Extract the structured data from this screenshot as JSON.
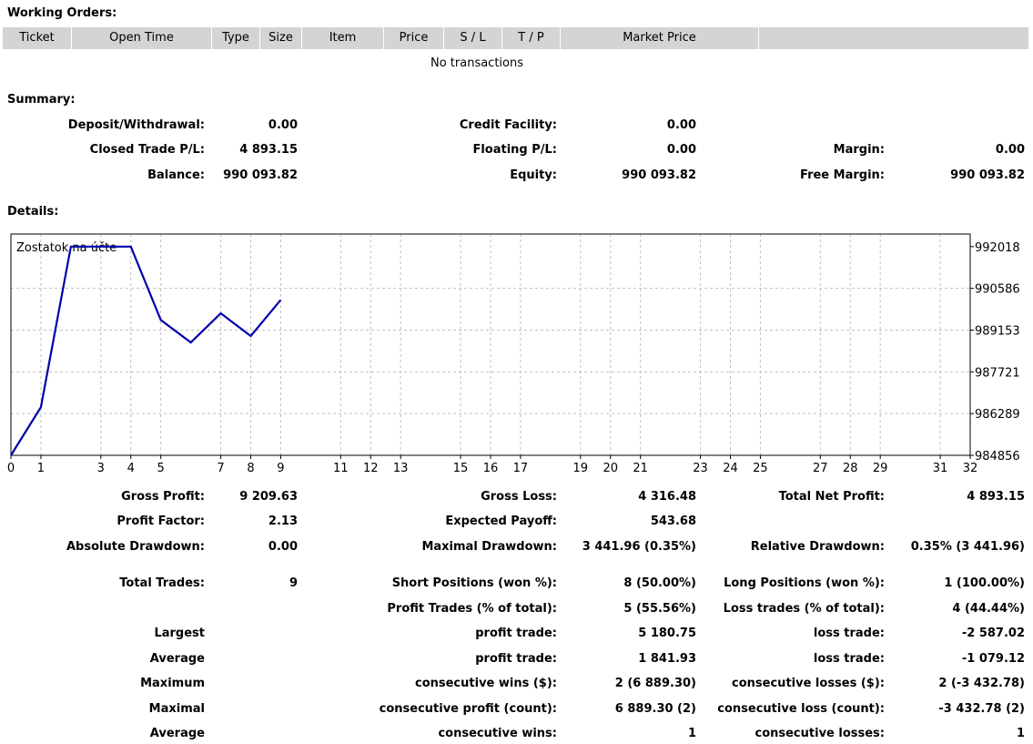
{
  "working_orders": {
    "title": "Working Orders:",
    "columns": [
      "Ticket",
      "Open Time",
      "Type",
      "Size",
      "Item",
      "Price",
      "S / L",
      "T / P",
      "Market Price"
    ],
    "empty_text": "No transactions"
  },
  "summary": {
    "title": "Summary:",
    "deposit_label": "Deposit/Withdrawal:",
    "deposit_value": "0.00",
    "credit_label": "Credit Facility:",
    "credit_value": "0.00",
    "closed_pl_label": "Closed Trade P/L:",
    "closed_pl_value": "4 893.15",
    "floating_pl_label": "Floating P/L:",
    "floating_pl_value": "0.00",
    "margin_label": "Margin:",
    "margin_value": "0.00",
    "balance_label": "Balance:",
    "balance_value": "990 093.82",
    "equity_label": "Equity:",
    "equity_value": "990 093.82",
    "free_margin_label": "Free Margin:",
    "free_margin_value": "990 093.82"
  },
  "details": {
    "title": "Details:"
  },
  "chart_data": {
    "type": "line",
    "title": "Zostatok na účte",
    "x": [
      0,
      1,
      2,
      3,
      4,
      5,
      6,
      7,
      8,
      9
    ],
    "series": [
      {
        "values": [
          984856,
          986510,
          992018,
          992018,
          992018,
          989500,
          988730,
          989730,
          988950,
          990190
        ]
      }
    ],
    "x_ticks": [
      0,
      1,
      3,
      4,
      5,
      7,
      8,
      9,
      11,
      12,
      13,
      15,
      16,
      17,
      19,
      20,
      21,
      23,
      24,
      25,
      27,
      28,
      29,
      31,
      32
    ],
    "y_ticks": [
      992018,
      990586,
      989153,
      987721,
      986289,
      984856
    ],
    "xlim": [
      0,
      32
    ],
    "ylim": [
      984856,
      992450
    ],
    "grid": true,
    "line_color": "#0000aa",
    "grid_color": "#c0c0c0"
  },
  "stats": {
    "gross_profit_label": "Gross Profit:",
    "gross_profit_value": "9 209.63",
    "gross_loss_label": "Gross Loss:",
    "gross_loss_value": "4 316.48",
    "total_net_label": "Total Net Profit:",
    "total_net_value": "4 893.15",
    "profit_factor_label": "Profit Factor:",
    "profit_factor_value": "2.13",
    "expected_payoff_label": "Expected Payoff:",
    "expected_payoff_value": "543.68",
    "abs_dd_label": "Absolute Drawdown:",
    "abs_dd_value": "0.00",
    "max_dd_label": "Maximal Drawdown:",
    "max_dd_value": "3 441.96 (0.35%)",
    "rel_dd_label": "Relative Drawdown:",
    "rel_dd_value": "0.35% (3 441.96)",
    "total_trades_label": "Total Trades:",
    "total_trades_value": "9",
    "short_pos_label": "Short Positions (won %):",
    "short_pos_value": "8 (50.00%)",
    "long_pos_label": "Long Positions (won %):",
    "long_pos_value": "1 (100.00%)",
    "profit_trades_label": "Profit Trades (% of total):",
    "profit_trades_value": "5 (55.56%)",
    "loss_trades_label": "Loss trades (% of total):",
    "loss_trades_value": "4 (44.44%)",
    "largest_label": "Largest",
    "largest_profit_label": "profit trade:",
    "largest_profit_value": "5 180.75",
    "largest_loss_label": "loss trade:",
    "largest_loss_value": "-2 587.02",
    "average_label": "Average",
    "avg_profit_label": "profit trade:",
    "avg_profit_value": "1 841.93",
    "avg_loss_label": "loss trade:",
    "avg_loss_value": "-1 079.12",
    "maximum_label": "Maximum",
    "max_cons_wins_label": "consecutive wins ($):",
    "max_cons_wins_value": "2 (6 889.30)",
    "max_cons_losses_label": "consecutive losses ($):",
    "max_cons_losses_value": "2 (-3 432.78)",
    "maximal_label": "Maximal",
    "maximal_cons_profit_label": "consecutive profit (count):",
    "maximal_cons_profit_value": "6 889.30 (2)",
    "maximal_cons_loss_label": "consecutive loss (count):",
    "maximal_cons_loss_value": "-3 432.78 (2)",
    "average2_label": "Average",
    "avg_cons_wins_label": "consecutive wins:",
    "avg_cons_wins_value": "1",
    "avg_cons_losses_label": "consecutive losses:",
    "avg_cons_losses_value": "1"
  }
}
